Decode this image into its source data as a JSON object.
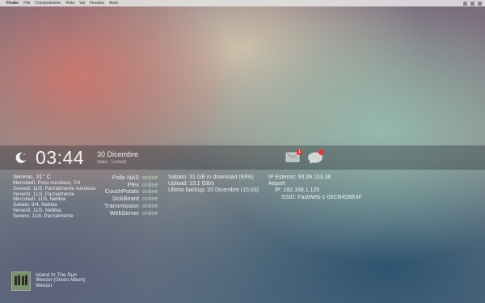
{
  "menubar": {
    "app": "Finder",
    "items": [
      "File",
      "Composizione",
      "Vista",
      "Vai",
      "Finestra",
      "Aiuto"
    ]
  },
  "clock": {
    "time": "03:44",
    "date": "30 Dicembre",
    "location": "Italia · Lunedì"
  },
  "notifications": {
    "mail_count": "1",
    "chat_count": ""
  },
  "weather": {
    "current": "Sereno, 31° C",
    "forecast": [
      "Mercoledì: Poco nuvoloso, 7/4",
      "Giovedì: 11/5, Parzialmente nuvoloso",
      "Venerdì: 11/3, Parzialmente",
      "Mercoledì: 11/5, Nebbia",
      "Sabato: 9/4, Nebbia",
      "Venerdì: 11/5, Nebbia",
      "Sereno: 11/4, Parzialmente"
    ]
  },
  "services": [
    {
      "name": "Pollo NAS",
      "status": "online"
    },
    {
      "name": "Plex",
      "status": "online"
    },
    {
      "name": "CouchPotato",
      "status": "online"
    },
    {
      "name": "SickBeard",
      "status": "online"
    },
    {
      "name": "Transmission",
      "status": "online"
    },
    {
      "name": "WebServer",
      "status": "online"
    }
  ],
  "downloads": [
    "Sabato: 31 GB in download (93%)",
    "Upload: 13.1 GB/s",
    "Ultimo backup: 20 Dicembre (15:03)"
  ],
  "network": {
    "ip_label": "IP Esterno: 93.39.103.38",
    "airport_label": "Airport",
    "ip_internal": "IP: 192.168.1.125",
    "ssid": "SSID: FastWeb-1-00CB4D8E4F"
  },
  "now_playing": {
    "title": "Island In The Sun",
    "artist": "Weezer (Green Album)",
    "album": "Weezer"
  },
  "colors": {
    "badge": "#e03a3a"
  }
}
